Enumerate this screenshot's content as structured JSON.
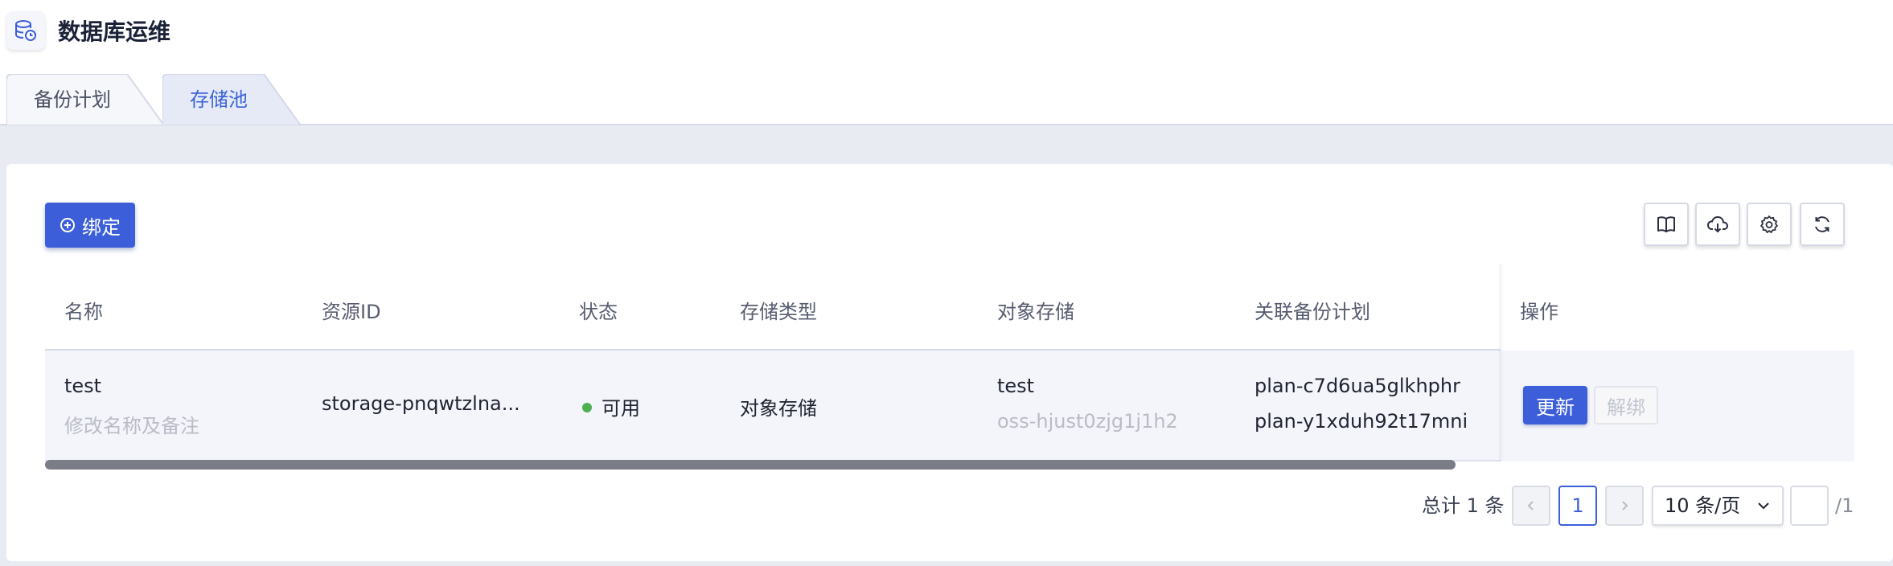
{
  "app": {
    "title": "数据库运维",
    "logo_icon": "database-clock-icon"
  },
  "tabs": [
    {
      "label": "备份计划",
      "active": false
    },
    {
      "label": "存储池",
      "active": true
    }
  ],
  "toolbar": {
    "bind_label": "绑定",
    "bind_icon": "plus-circle-icon",
    "actions": [
      "book-icon",
      "cloud-download-icon",
      "gear-icon",
      "refresh-icon"
    ]
  },
  "table": {
    "columns": [
      "名称",
      "资源ID",
      "状态",
      "存储类型",
      "对象存储",
      "关联备份计划",
      "操作"
    ],
    "rows": [
      {
        "name": "test",
        "name_hint": "修改名称及备注",
        "resource_id": "storage-pnqwtzlna...",
        "status": "可用",
        "storage_type": "对象存储",
        "object_storage": "test",
        "object_storage_id": "oss-hjust0zjg1j1h2",
        "plans": [
          "plan-c7d6ua5glkhphr",
          "plan-y1xduh92t17mni"
        ],
        "actions": {
          "update": "更新",
          "unbind": "解绑"
        }
      }
    ]
  },
  "pagination": {
    "total_text": "总计 1 条",
    "current_page": "1",
    "page_size": "10 条/页",
    "total_pages": "/1"
  },
  "colors": {
    "primary": "#3c5fd9",
    "status_ok": "#4caf50"
  }
}
